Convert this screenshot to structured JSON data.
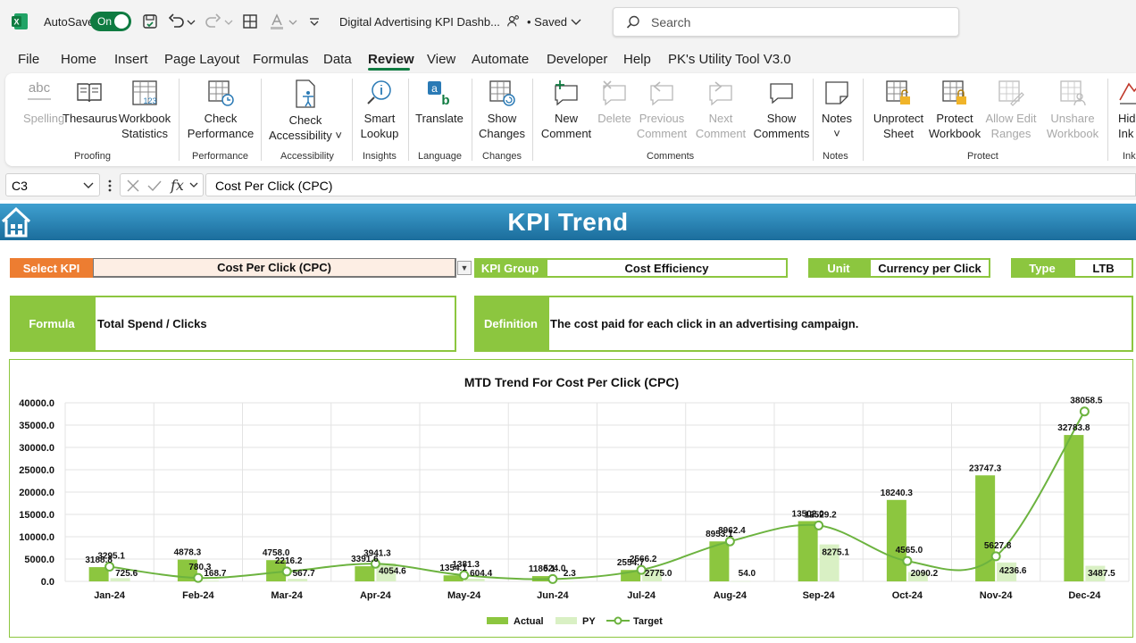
{
  "titlebar": {
    "autosave_label": "AutoSave",
    "autosave_state": "On",
    "doc_title": "Digital Advertising KPI Dashb...",
    "saved": "• Saved",
    "search_placeholder": "Search"
  },
  "menu": [
    "File",
    "Home",
    "Insert",
    "Page Layout",
    "Formulas",
    "Data",
    "Review",
    "View",
    "Automate",
    "Developer",
    "Help",
    "PK's Utility Tool V3.0"
  ],
  "ribbon": {
    "buttons": [
      {
        "l1": "abc",
        "l2": "Spelling",
        "l3": "",
        "dis": true
      },
      {
        "l1": "Thesaurus",
        "l2": "",
        "l3": "",
        "dis": false
      },
      {
        "l1": "Workbook",
        "l2": "Statistics",
        "l3": "",
        "dis": false
      },
      {
        "l1": "Check",
        "l2": "Performance",
        "l3": "",
        "dis": false
      },
      {
        "l1": "Check",
        "l2": "Accessibility ˅",
        "l3": "",
        "dis": false
      },
      {
        "l1": "Smart",
        "l2": "Lookup",
        "l3": "",
        "dis": false
      },
      {
        "l1": "Translate",
        "l2": "",
        "l3": "",
        "dis": false
      },
      {
        "l1": "Show",
        "l2": "Changes",
        "l3": "",
        "dis": false
      },
      {
        "l1": "New",
        "l2": "Comment",
        "l3": "",
        "dis": false
      },
      {
        "l1": "Delete",
        "l2": "",
        "l3": "",
        "dis": true
      },
      {
        "l1": "Previous",
        "l2": "Comment",
        "l3": "",
        "dis": true
      },
      {
        "l1": "Next",
        "l2": "Comment",
        "l3": "",
        "dis": true
      },
      {
        "l1": "Show",
        "l2": "Comments",
        "l3": "",
        "dis": false
      },
      {
        "l1": "Notes",
        "l2": "˅",
        "l3": "",
        "dis": false
      },
      {
        "l1": "Unprotect",
        "l2": "Sheet",
        "l3": "",
        "dis": false
      },
      {
        "l1": "Protect",
        "l2": "Workbook",
        "l3": "",
        "dis": false
      },
      {
        "l1": "Allow Edit",
        "l2": "Ranges",
        "l3": "",
        "dis": true
      },
      {
        "l1": "Unshare",
        "l2": "Workbook",
        "l3": "",
        "dis": true
      },
      {
        "l1": "Hid",
        "l2": "Ink ˅",
        "l3": "",
        "dis": false
      }
    ],
    "groups": [
      "Proofing",
      "Performance",
      "Accessibility",
      "Insights",
      "Language",
      "Changes",
      "Comments",
      "Notes",
      "Protect",
      "Ink"
    ]
  },
  "formula_bar": {
    "cell": "C3",
    "value": "Cost Per Click (CPC)"
  },
  "sheet": {
    "banner": "KPI Trend",
    "select_kpi_label": "Select KPI",
    "select_kpi_value": "Cost Per Click (CPC)",
    "kpi_group_label": "KPI Group",
    "kpi_group_value": "Cost Efficiency",
    "unit_label": "Unit",
    "unit_value": "Currency per Click",
    "type_label": "Type",
    "type_value": "LTB",
    "formula_label": "Formula",
    "formula_value": "Total Spend / Clicks",
    "definition_label": "Definition",
    "definition_value": "The cost paid for each click in an advertising campaign."
  },
  "colors": {
    "green": "#8cc63f",
    "light_green": "#d9f0c4",
    "orange": "#ed7d31",
    "banner": "#1b6d9c",
    "accent": "#0f7b41"
  },
  "chart_data": {
    "type": "bar",
    "title": "MTD Trend For Cost Per Click (CPC)",
    "categories": [
      "Jan-24",
      "Feb-24",
      "Mar-24",
      "Apr-24",
      "May-24",
      "Jun-24",
      "Jul-24",
      "Aug-24",
      "Sep-24",
      "Oct-24",
      "Nov-24",
      "Dec-24"
    ],
    "ylim": [
      0,
      40000
    ],
    "yticks": [
      "0.0",
      "5000.0",
      "10000.0",
      "15000.0",
      "20000.0",
      "25000.0",
      "30000.0",
      "35000.0",
      "40000.0"
    ],
    "series": [
      {
        "name": "Actual",
        "type": "bar",
        "values": [
          3188.8,
          4878.3,
          4758.0,
          3391.6,
          1354.1,
          1186.1,
          2554.7,
          8953.1,
          13502.0,
          18240.3,
          23747.3,
          32783.8
        ]
      },
      {
        "name": "PY",
        "type": "bar",
        "values": [
          725.6,
          168.7,
          567.7,
          4054.6,
          604.4,
          2.3,
          2775.0,
          54.0,
          8275.1,
          2090.2,
          4236.6,
          3487.5
        ]
      },
      {
        "name": "Target",
        "type": "line",
        "values": [
          3295.1,
          780.3,
          2216.2,
          3941.3,
          1381.3,
          524.0,
          2566.2,
          8962.4,
          12529.2,
          4565.0,
          5627.8,
          38058.5
        ]
      }
    ],
    "legend": "bottom",
    "grid": true
  }
}
